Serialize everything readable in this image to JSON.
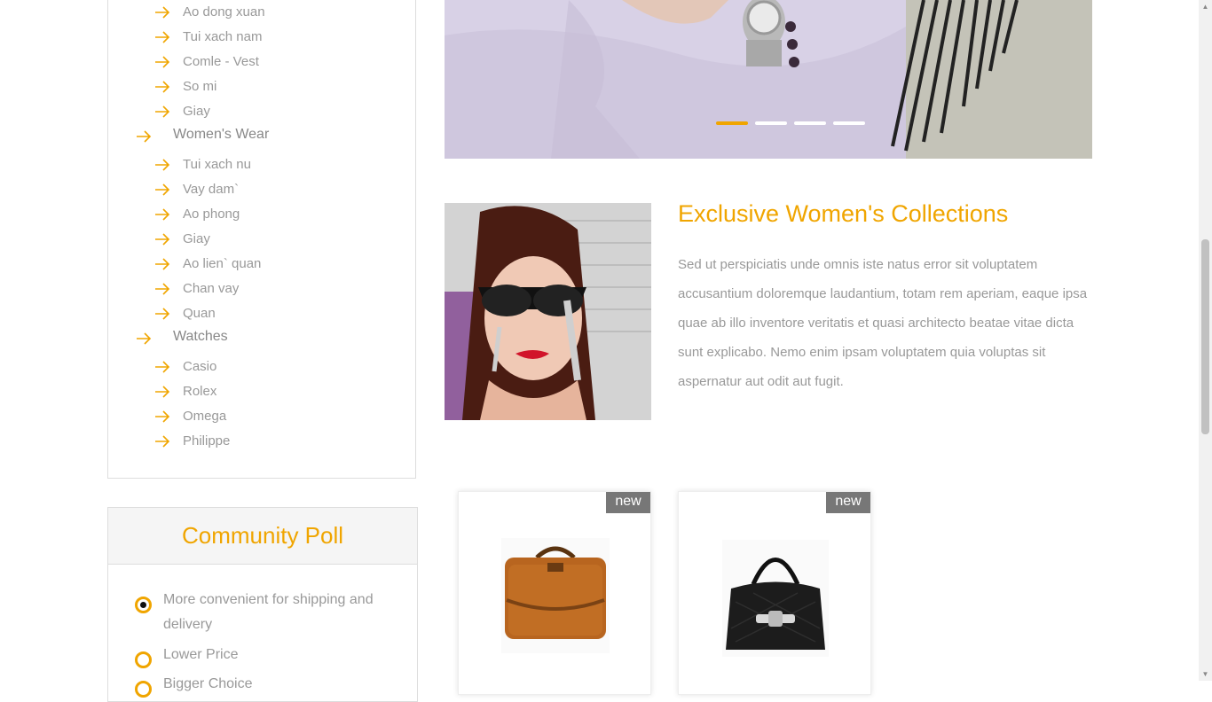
{
  "sidebar": {
    "items": [
      {
        "label": "Ao dong xuan",
        "type": "sub"
      },
      {
        "label": "Tui xach nam",
        "type": "sub"
      },
      {
        "label": "Comle - Vest",
        "type": "sub"
      },
      {
        "label": "So mi",
        "type": "sub"
      },
      {
        "label": "Giay",
        "type": "sub"
      },
      {
        "label": "Women's Wear",
        "type": "group"
      },
      {
        "label": "Tui xach nu",
        "type": "sub"
      },
      {
        "label": "Vay dam`",
        "type": "sub"
      },
      {
        "label": "Ao phong",
        "type": "sub"
      },
      {
        "label": "Giay",
        "type": "sub"
      },
      {
        "label": "Ao lien` quan",
        "type": "sub"
      },
      {
        "label": "Chan vay",
        "type": "sub"
      },
      {
        "label": "Quan",
        "type": "sub"
      },
      {
        "label": "Watches",
        "type": "group"
      },
      {
        "label": "Casio",
        "type": "sub"
      },
      {
        "label": "Rolex",
        "type": "sub"
      },
      {
        "label": "Omega",
        "type": "sub"
      },
      {
        "label": "Philippe",
        "type": "sub"
      }
    ]
  },
  "poll": {
    "title": "Community Poll",
    "options": [
      {
        "label": "More convenient for shipping and delivery",
        "checked": true
      },
      {
        "label": "Lower Price",
        "checked": false
      },
      {
        "label": "Bigger Choice",
        "checked": false
      }
    ]
  },
  "slider": {
    "active_index": 0,
    "dot_count": 4
  },
  "feature": {
    "title": "Exclusive Women's Collections",
    "text": "Sed ut perspiciatis unde omnis iste natus error sit voluptatem accusantium doloremque laudantium, totam rem aperiam, eaque ipsa quae ab illo inventore veritatis et quasi architecto beatae vitae dicta sunt explicabo. Nemo enim ipsam voluptatem quia voluptas sit aspernatur aut odit aut fugit."
  },
  "products": [
    {
      "badge": "new",
      "image": "brown-leather-briefcase"
    },
    {
      "badge": "new",
      "image": "black-handbag"
    }
  ],
  "colors": {
    "accent": "#f0a500",
    "text": "#999999",
    "badge": "#777777"
  },
  "icons": {
    "list_bullet": "arrow-right-icon"
  }
}
